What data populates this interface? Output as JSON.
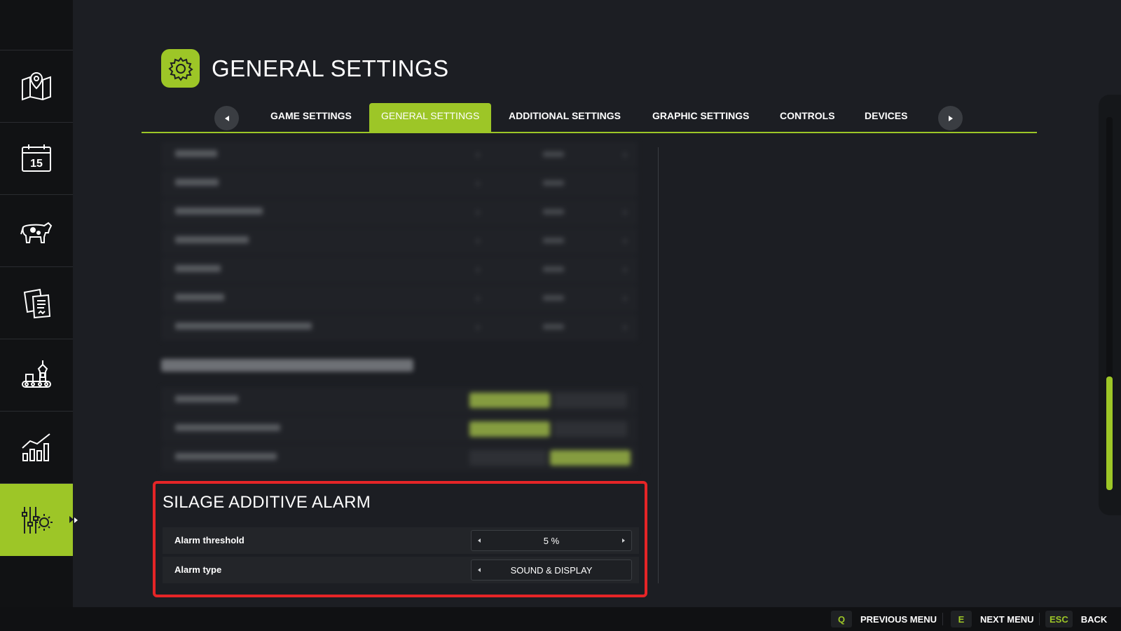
{
  "header": {
    "title": "GENERAL SETTINGS",
    "icon": "gear-icon"
  },
  "sidebar": {
    "items": [
      {
        "icon": "map-icon",
        "active": false
      },
      {
        "icon": "calendar-icon",
        "active": false
      },
      {
        "icon": "cow-icon",
        "active": false
      },
      {
        "icon": "contracts-icon",
        "active": false
      },
      {
        "icon": "production-icon",
        "active": false
      },
      {
        "icon": "statistics-icon",
        "active": false
      },
      {
        "icon": "settings-icon",
        "active": true
      }
    ],
    "calendar_day": "15"
  },
  "tabs": [
    {
      "label": "GAME SETTINGS"
    },
    {
      "label": "GENERAL SETTINGS",
      "active": true
    },
    {
      "label": "ADDITIONAL SETTINGS"
    },
    {
      "label": "GRAPHIC SETTINGS"
    },
    {
      "label": "CONTROLS"
    },
    {
      "label": "DEVICES"
    }
  ],
  "section": {
    "title": "SILAGE ADDITIVE ALARM",
    "rows": [
      {
        "label": "Alarm threshold",
        "value": "5 %"
      },
      {
        "label": "Alarm type",
        "value": "SOUND & DISPLAY"
      }
    ]
  },
  "footer": {
    "hints": [
      {
        "key": "Q",
        "label": "PREVIOUS MENU"
      },
      {
        "key": "E",
        "label": "NEXT MENU"
      },
      {
        "key": "ESC",
        "label": "BACK"
      }
    ]
  },
  "colors": {
    "accent": "#9dc627",
    "highlight": "#e52527",
    "background": "#1c1e23"
  },
  "scrollbar": {
    "position_fraction": 0.7
  }
}
